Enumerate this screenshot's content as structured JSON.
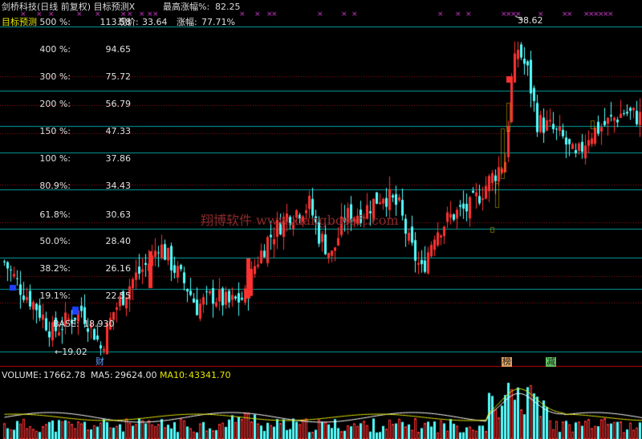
{
  "header": {
    "title": "剑桥科技(日线 前复权) 目标预测X",
    "max_gain_label": "最高涨幅%:",
    "max_gain_value": "82.25",
    "indicator_tag": "目标预测",
    "target_500_value": "113.58",
    "current_price_label": "现价:",
    "current_price_value": "33.64",
    "gain_label": "涨幅:",
    "gain_value": "77.71%"
  },
  "levels": [
    {
      "pct": "500 %:",
      "value": "113.58"
    },
    {
      "pct": "400 %:",
      "value": "94.65"
    },
    {
      "pct": "300 %:",
      "value": "75.72"
    },
    {
      "pct": "200 %:",
      "value": "56.79"
    },
    {
      "pct": "150 %:",
      "value": "47.33"
    },
    {
      "pct": "100 %:",
      "value": "37.86"
    },
    {
      "pct": "80.9%:",
      "value": "34.43"
    },
    {
      "pct": "61.8%:",
      "value": "30.63"
    },
    {
      "pct": "50.0%:",
      "value": "28.40"
    },
    {
      "pct": "38.2%:",
      "value": "26.16"
    },
    {
      "pct": "19.1%:",
      "value": "22.55"
    }
  ],
  "base": {
    "label": "BASE:",
    "value": "18.930"
  },
  "price_annotations": {
    "low": "←19.02",
    "high": "38.62"
  },
  "event_markers": {
    "cai": "财",
    "bang": "榜",
    "jian": "减"
  },
  "watermark": "翔博软件 www.xiangbosoft.com",
  "volume_panel": {
    "volume_label": "VOLUME:",
    "volume_value": "17662.78",
    "ma5_label": "MA5:",
    "ma5_value": "29624.00",
    "ma10_label": "MA10:",
    "ma10_value": "43341.70"
  },
  "colors": {
    "up": "#ff3232",
    "down": "#54ffff",
    "level_line": "#00a0a0",
    "dotted_line": "#a01010",
    "ma5": "#ffffff",
    "ma10": "#e6e600",
    "top_marks": "#e040e0"
  }
}
